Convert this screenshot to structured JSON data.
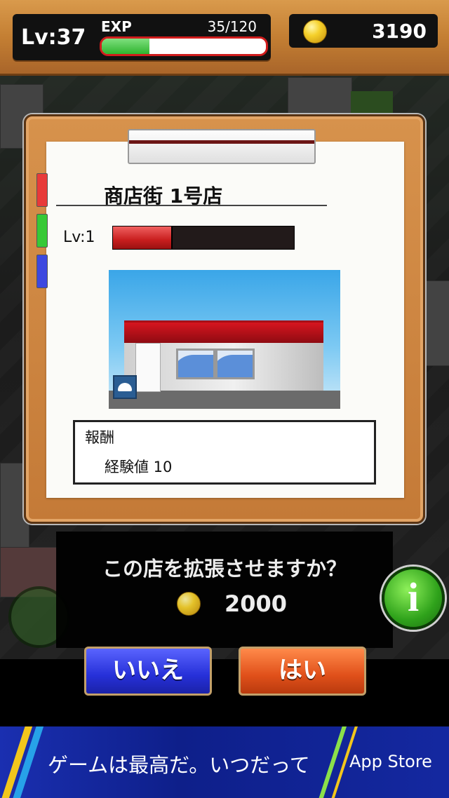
{
  "player": {
    "level_label": "Lv:37",
    "exp_label": "EXP",
    "exp_value": "35/120",
    "exp_progress": 0.29,
    "coins": "3190"
  },
  "shop": {
    "name": "商店街 1号店",
    "level_label": "Lv:1",
    "level_progress": 0.33,
    "reward_title": "報酬",
    "reward_text": "経験値 10"
  },
  "confirm": {
    "question": "この店を拡張させますか？",
    "cost": "2000",
    "no_label": "いいえ",
    "yes_label": "はい"
  },
  "info_button": {
    "label": "i"
  },
  "ad": {
    "text": "ゲームは最高だ。いつだって",
    "store": " App Store"
  },
  "colors": {
    "exp_fill": "#2eb42e",
    "shop_bar_fill": "#c81e1e",
    "no_button": "#2630d8",
    "yes_button": "#e0501a",
    "wood": "#c47f33"
  }
}
